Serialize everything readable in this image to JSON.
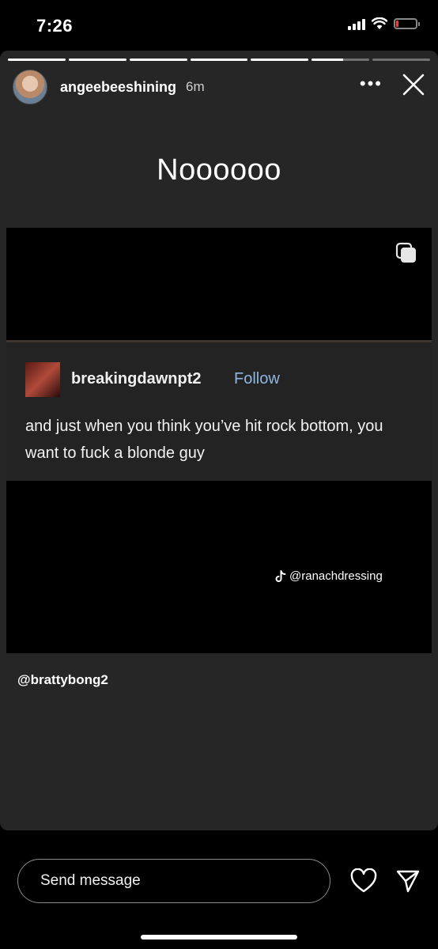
{
  "status_bar": {
    "time": "7:26"
  },
  "story": {
    "progress": [
      1,
      1,
      1,
      1,
      1,
      0.55,
      0
    ],
    "username": "angeebeeshining",
    "time_ago": "6m",
    "caption": "Noooooo",
    "post": {
      "username": "breakingdawnpt2",
      "follow_label": "Follow",
      "text": "and just when you think you’ve hit rock bottom, you want to fuck a blonde guy",
      "tiktok_handle": "@ranachdressing"
    },
    "mention": "@brattybong2"
  },
  "footer": {
    "send_placeholder": "Send message"
  }
}
